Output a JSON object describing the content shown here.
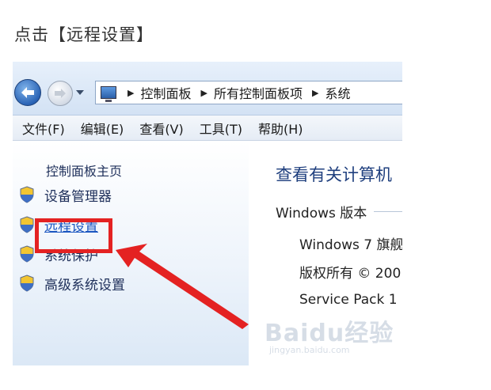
{
  "instruction": "点击【远程设置】",
  "address_bar": {
    "breadcrumbs": [
      "控制面板",
      "所有控制面板项",
      "系统"
    ],
    "icons": {
      "back": "back-arrow-icon",
      "forward": "forward-arrow-icon",
      "location": "computer-icon"
    }
  },
  "menu": [
    "文件(F)",
    "编辑(E)",
    "查看(V)",
    "工具(T)",
    "帮助(H)"
  ],
  "left_pane": {
    "home": "控制面板主页",
    "tasks": [
      "设备管理器",
      "远程设置",
      "系统保护",
      "高级系统设置"
    ],
    "highlighted_task": "远程设置"
  },
  "right_pane": {
    "title": "查看有关计算机",
    "section": "Windows 版本",
    "rows": [
      "Windows 7 旗舰",
      "版权所有 © 200",
      "Service Pack 1"
    ]
  },
  "watermark": {
    "main": "Baidu经验",
    "sub": "jingyan.baidu.com"
  },
  "colors": {
    "highlight": "#e42222",
    "link": "#1a55c0",
    "pane_text": "#1e2f5a",
    "title": "#1f3f7e"
  }
}
